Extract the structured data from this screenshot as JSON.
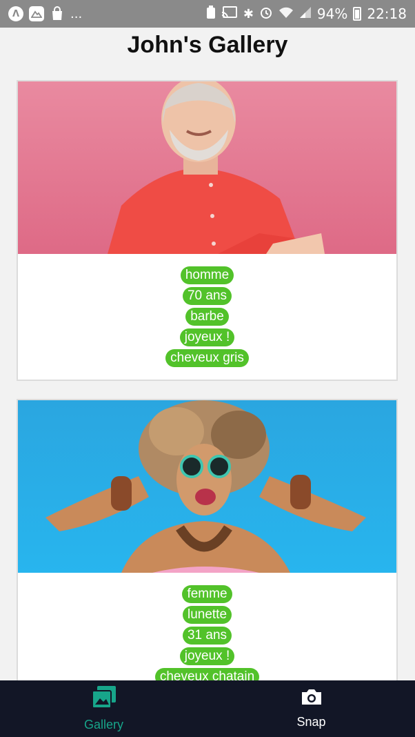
{
  "status_bar": {
    "left_icons": [
      "lambda-icon",
      "mountain-icon",
      "bag-icon"
    ],
    "ellipsis": "...",
    "battery": "94%",
    "time": "22:18"
  },
  "header": {
    "title": "John's Gallery"
  },
  "cards": [
    {
      "photo": "man-smiling-photo",
      "tags": [
        "homme",
        "70 ans",
        "barbe",
        "joyeux !",
        "cheveux gris"
      ]
    },
    {
      "photo": "woman-sunglasses-photo",
      "tags": [
        "femme",
        "lunette",
        "31 ans",
        "joyeux !",
        "cheveux chatain"
      ]
    }
  ],
  "tab_bar": {
    "items": [
      {
        "label": "Gallery",
        "icon": "gallery-icon",
        "active": true
      },
      {
        "label": "Snap",
        "icon": "camera-icon",
        "active": false
      }
    ]
  },
  "colors": {
    "tag": "#52c22a",
    "tab_active": "#17a58a",
    "tab_bar_bg": "#121626",
    "status_bar_bg": "#8a8a8a"
  }
}
